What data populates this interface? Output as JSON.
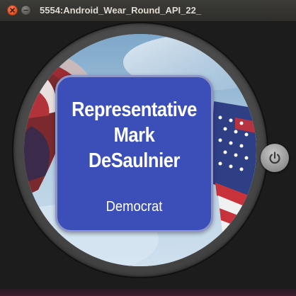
{
  "window": {
    "title": "5554:Android_Wear_Round_API_22_"
  },
  "titlebar_buttons": {
    "close_icon": "close-icon",
    "minimize_icon": "minimize-icon"
  },
  "watch": {
    "background_image": "american-flag-sky",
    "card": {
      "name_line1": "Representative",
      "name_line2": "Mark",
      "name_line3": "DeSaulnier",
      "party": "Democrat",
      "card_color": "#3c4fb9",
      "card_border_color": "#8e96c8"
    }
  },
  "side_controls": {
    "power_icon": "power-icon"
  }
}
